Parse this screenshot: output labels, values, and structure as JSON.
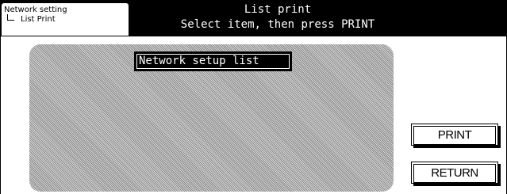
{
  "breadcrumb": {
    "root": "Network setting",
    "child": "List Print"
  },
  "header": {
    "title": "List print",
    "instruction": "Select item, then press PRINT"
  },
  "list": {
    "items": [
      {
        "label": "Network setup list",
        "selected": true
      }
    ]
  },
  "buttons": {
    "print": "PRINT",
    "return": "RETURN"
  },
  "colors": {
    "header_bg": "#000000",
    "panel_pattern_dark": "#8a8a8a",
    "panel_pattern_light": "#d6d6d6",
    "selected_bg": "#000000",
    "text_on_dark": "#ffffff"
  }
}
